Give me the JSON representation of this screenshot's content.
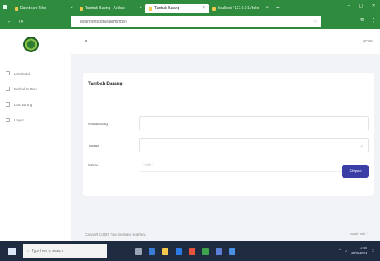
{
  "browser": {
    "tabs": [
      {
        "label": "Dashboard Toko",
        "active": false
      },
      {
        "label": "Tambah Barang - Aplikasi",
        "active": false
      },
      {
        "label": "Tambah Barang",
        "active": true
      },
      {
        "label": "localhost / 127.0.0.1 / toko",
        "active": false
      }
    ],
    "url": "localhost/toko/barang/tambah"
  },
  "topbar": {
    "hamburger": "≡",
    "user": "profile"
  },
  "sidebar": {
    "items": [
      {
        "label": "Dashboard",
        "icon": "dashboard-icon"
      },
      {
        "label": "Pembelian Baru",
        "icon": "cart-icon"
      },
      {
        "label": "Data Barang",
        "icon": "box-icon"
      },
      {
        "label": "Logout",
        "icon": "logout-icon"
      }
    ]
  },
  "form": {
    "title": "Tambah Barang",
    "fields": [
      {
        "label": "Nama Barang",
        "value": "",
        "placeholder": ""
      },
      {
        "label": "Tanggal",
        "value": "",
        "placeholder": ""
      },
      {
        "label": "Satuan",
        "value": "",
        "placeholder": "- Pilih -"
      }
    ],
    "submit": "Simpan"
  },
  "footer": {
    "left": "Copyright © 2021 Toko Sembako Sejahtera",
    "right": "Made with ♡"
  },
  "taskbar": {
    "search_placeholder": "Type here to search",
    "time": "10:45",
    "date": "25/06/2021"
  }
}
